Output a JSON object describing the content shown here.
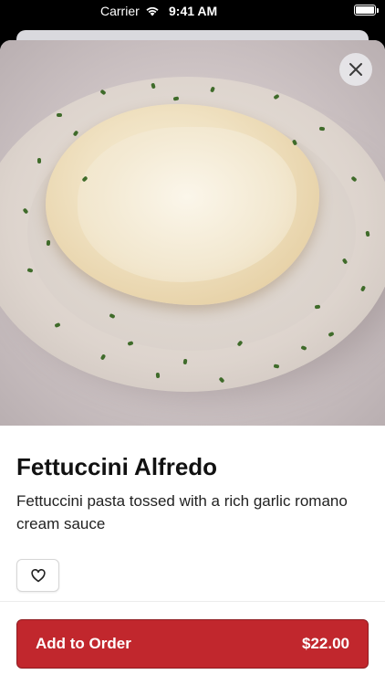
{
  "status_bar": {
    "carrier": "Carrier",
    "time": "9:41 AM"
  },
  "item": {
    "name": "Fettuccini Alfredo",
    "description": "Fettuccini pasta tossed with a rich garlic romano cream sauce",
    "price": "$22.00"
  },
  "actions": {
    "add_label": "Add to Order"
  },
  "icons": {
    "close": "close-icon",
    "favorite": "heart-icon",
    "wifi": "wifi-icon",
    "battery": "battery-icon"
  },
  "colors": {
    "accent": "#c1272d",
    "text_primary": "#111111"
  }
}
